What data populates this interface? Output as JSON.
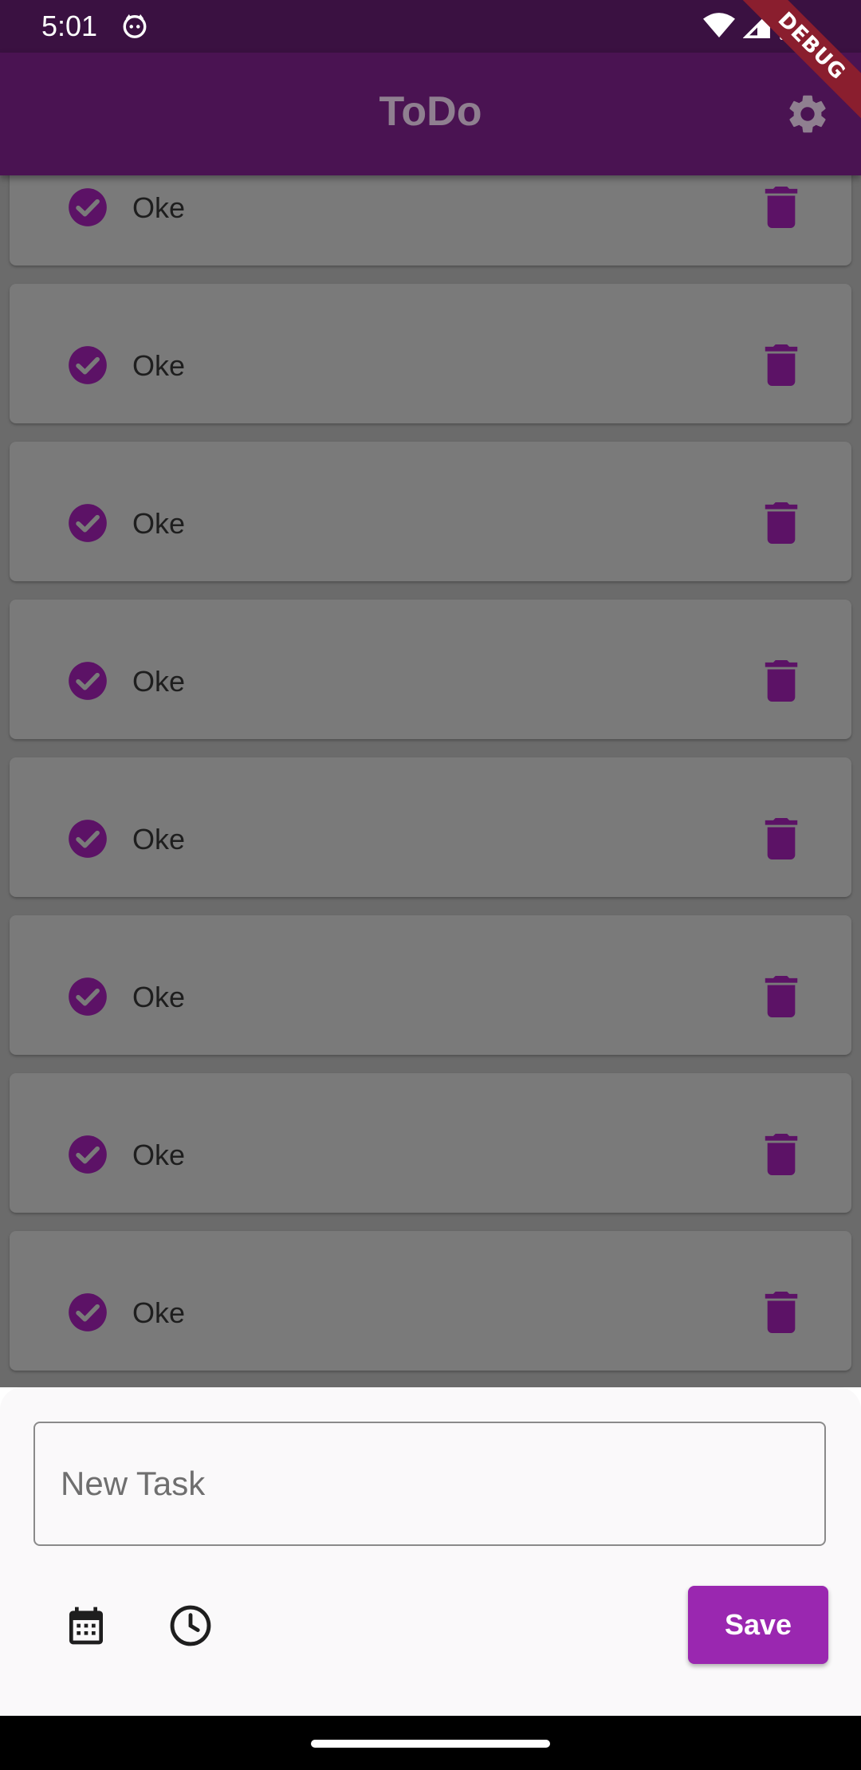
{
  "status_bar": {
    "time": "5:01"
  },
  "app_bar": {
    "title": "ToDo",
    "debug_label": "DEBUG"
  },
  "tasks": [
    {
      "label": "Oke",
      "done": true
    },
    {
      "label": "Oke",
      "done": true
    },
    {
      "label": "Oke",
      "done": true
    },
    {
      "label": "Oke",
      "done": true
    },
    {
      "label": "Oke",
      "done": true
    },
    {
      "label": "Oke",
      "done": true
    },
    {
      "label": "Oke",
      "done": true
    },
    {
      "label": "Oke",
      "done": true
    }
  ],
  "sheet": {
    "input_placeholder": "New Task",
    "input_value": "",
    "save_label": "Save"
  },
  "colors": {
    "accent": "#9a27b0",
    "app_bar": "#4a1352",
    "icon_dark_purple": "#5c1266"
  },
  "icons": [
    "check-circle-icon",
    "delete-icon",
    "settings-icon",
    "calendar-icon",
    "clock-icon"
  ]
}
